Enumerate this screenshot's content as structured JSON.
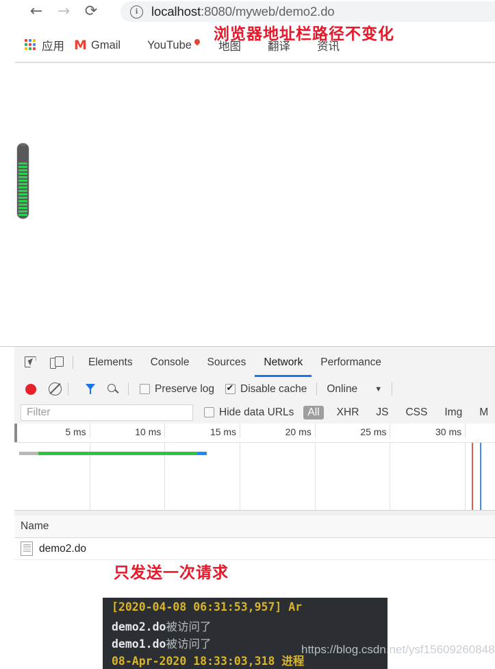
{
  "browser": {
    "nav": {
      "back_icon": "arrow-left-icon",
      "forward_icon": "arrow-right-icon",
      "reload_icon": "reload-icon",
      "back_glyph": "←",
      "forward_glyph": "→",
      "reload_glyph": "⟳"
    },
    "omnibox": {
      "info_glyph": "i",
      "host": "localhost",
      "path": ":8080/myweb/demo2.do",
      "full_url": "localhost:8080/myweb/demo2.do"
    },
    "bookmarks": [
      {
        "label": "应用",
        "icon": "apps-grid-icon"
      },
      {
        "label": "Gmail",
        "icon": "gmail-icon",
        "glyph": "M"
      },
      {
        "label": "YouTube",
        "icon": "youtube-icon"
      },
      {
        "label": "地图",
        "icon": "maps-icon"
      },
      {
        "label": "翻译",
        "icon": "globe-icon"
      },
      {
        "label": "资讯",
        "icon": "globe-icon"
      }
    ],
    "apps_icon_colors": [
      "#ea4335",
      "#4285f4",
      "#fbbc04",
      "#34a853",
      "#ea4335",
      "#4285f4",
      "#fbbc04",
      "#34a853",
      "#ea4335"
    ]
  },
  "annotations": {
    "url_note": "浏览器地址栏路径不变化",
    "request_note": "只发送一次请求",
    "color": "#e8172a"
  },
  "page": {
    "meter": {
      "name": "vertical-segmented-meter",
      "fill_percent": 72
    }
  },
  "devtools": {
    "toolbar_icons": {
      "inspect": "inspect-element-icon",
      "device": "device-toolbar-icon"
    },
    "tabs": [
      {
        "label": "Elements",
        "active": false
      },
      {
        "label": "Console",
        "active": false
      },
      {
        "label": "Sources",
        "active": false
      },
      {
        "label": "Network",
        "active": true
      },
      {
        "label": "Performance",
        "active": false
      }
    ],
    "active_tab_underline": "#1a73e8",
    "network_toolbar": {
      "record_icon": "record-button",
      "record_color": "#e8202a",
      "clear_icon": "clear-icon",
      "filter_icon": "filter-funnel-icon",
      "search_icon": "search-icon",
      "preserve_log": {
        "label": "Preserve log",
        "checked": false
      },
      "disable_cache": {
        "label": "Disable cache",
        "checked": true
      },
      "throttle": {
        "label": "Online",
        "caret": "▼"
      }
    },
    "filter_bar": {
      "filter_placeholder": "Filter",
      "hide_data_urls": {
        "label": "Hide data URLs",
        "checked": false
      },
      "types": [
        {
          "label": "All",
          "active": true
        },
        {
          "label": "XHR",
          "active": false
        },
        {
          "label": "JS",
          "active": false
        },
        {
          "label": "CSS",
          "active": false
        },
        {
          "label": "Img",
          "active": false
        },
        {
          "label": "M",
          "active": false
        }
      ]
    },
    "timeline": {
      "ticks": [
        "5 ms",
        "10 ms",
        "15 ms",
        "20 ms",
        "25 ms",
        "30 ms"
      ],
      "request_bar": {
        "segments": [
          {
            "name": "queue",
            "color": "#b8b8b8",
            "start_pct": 1,
            "width_pct": 4
          },
          {
            "name": "download",
            "color": "#2bc53f",
            "start_pct": 5,
            "width_pct": 33
          },
          {
            "name": "finish",
            "color": "#1a8cff",
            "start_pct": 38,
            "width_pct": 2
          }
        ]
      },
      "markers": [
        {
          "name": "dom-content-loaded",
          "color": "#e35b52",
          "pos_pct": 95.2
        },
        {
          "name": "load",
          "color": "#4285f4",
          "pos_pct": 96.9
        }
      ]
    },
    "table": {
      "columns": [
        "Name"
      ],
      "rows": [
        {
          "name": "demo2.do",
          "icon": "document-icon"
        }
      ]
    }
  },
  "console": {
    "lines": [
      {
        "timestamp": "[2020-04-08 06:31:53,957]",
        "rest": " Ar",
        "type": "log-header"
      },
      {
        "mono": "demo2.do",
        "cn": "被访问了",
        "type": "message"
      },
      {
        "mono": "demo1.do",
        "cn": "被访问了",
        "type": "message"
      },
      {
        "text": "08-Apr-2020 18:33:03,318 进程",
        "type": "log-header-cut"
      }
    ]
  },
  "watermark": {
    "bright": "https://blog.csdn.",
    "dim": "net/ysf15609260848"
  }
}
